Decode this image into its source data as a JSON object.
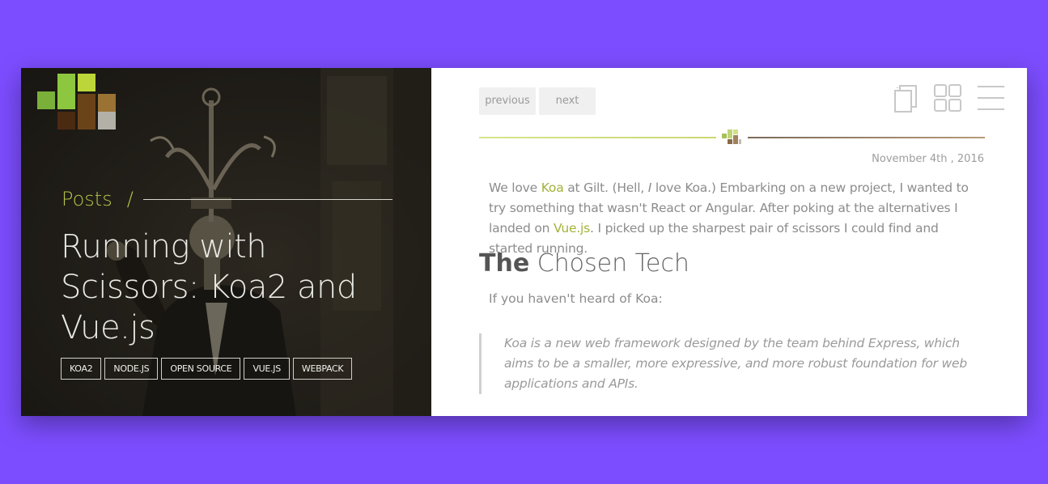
{
  "colors": {
    "background": "#7c4dff",
    "accent": "#a4b23a",
    "hero_text": "#e9e9e4"
  },
  "hero": {
    "breadcrumb": "Posts",
    "breadcrumb_separator": "/",
    "title": "Running with Scissors: Koa2 and Vue.js",
    "tags": [
      "KOA2",
      "NODE.JS",
      "OPEN SOURCE",
      "VUE.JS",
      "WEBPACK"
    ]
  },
  "toolbar": {
    "previous_label": "previous",
    "next_label": "next",
    "icons": [
      "copy-icon",
      "grid-icon",
      "menu-icon"
    ]
  },
  "article": {
    "date": "November 4th , 2016",
    "intro": {
      "p1": "We love ",
      "koa_link": "Koa",
      "p2": " at Gilt. (Hell, ",
      "i": "I",
      "p3": " love Koa.) Embarking on a new project, I wanted to try something that wasn't React or Angular. After poking at the alternatives I landed on ",
      "vue_link": "Vue.js",
      "p4": ". I picked up the sharpest pair of scissors I could find and started running."
    },
    "heading_strong": "The",
    "heading_light": "Chosen Tech",
    "para2": "If you haven't heard of Koa:",
    "quote": "Koa is a new web framework designed by the team behind Express, which aims to be a smaller, more expressive, and more robust foundation for web applications and APIs."
  }
}
